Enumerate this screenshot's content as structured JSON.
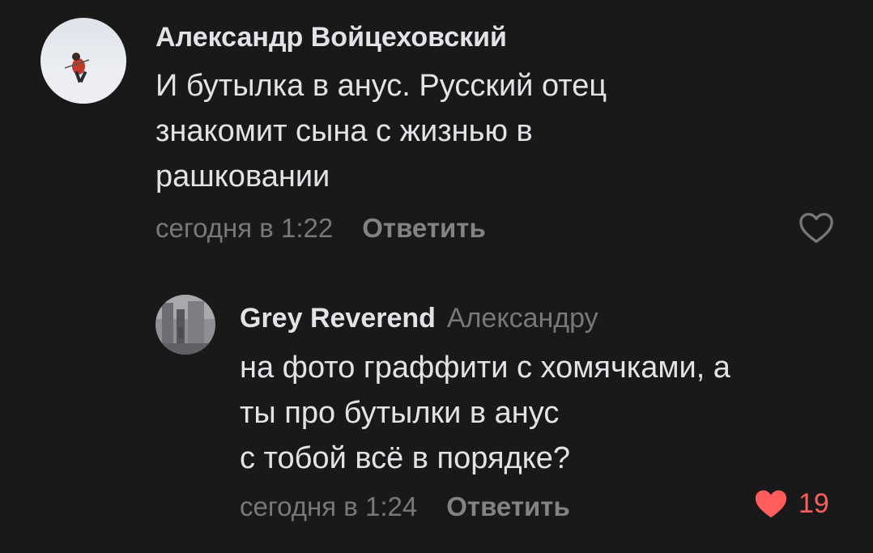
{
  "comments": [
    {
      "author": "Александр Войцеховский",
      "text": "И бутылка в анус. Русский отец\nзнакомит сына с жизнью в\nрашковании",
      "time": "сегодня в 1:22",
      "reply_label": "Ответить",
      "liked": false,
      "like_count": ""
    },
    {
      "author": "Grey Reverend",
      "reply_to": "Александру",
      "text": "на фото граффити с хомячками, а\nты про бутылки в анус\nс тобой всё в порядке?",
      "time": "сегодня в 1:24",
      "reply_label": "Ответить",
      "liked": true,
      "like_count": "19"
    }
  ],
  "colors": {
    "background": "#19191a",
    "text": "#e1e3e6",
    "secondary": "#76787a",
    "like_active": "#ff5c5c"
  },
  "icons": {
    "like_outline": "heart-outline-icon",
    "like_filled": "heart-filled-icon"
  }
}
